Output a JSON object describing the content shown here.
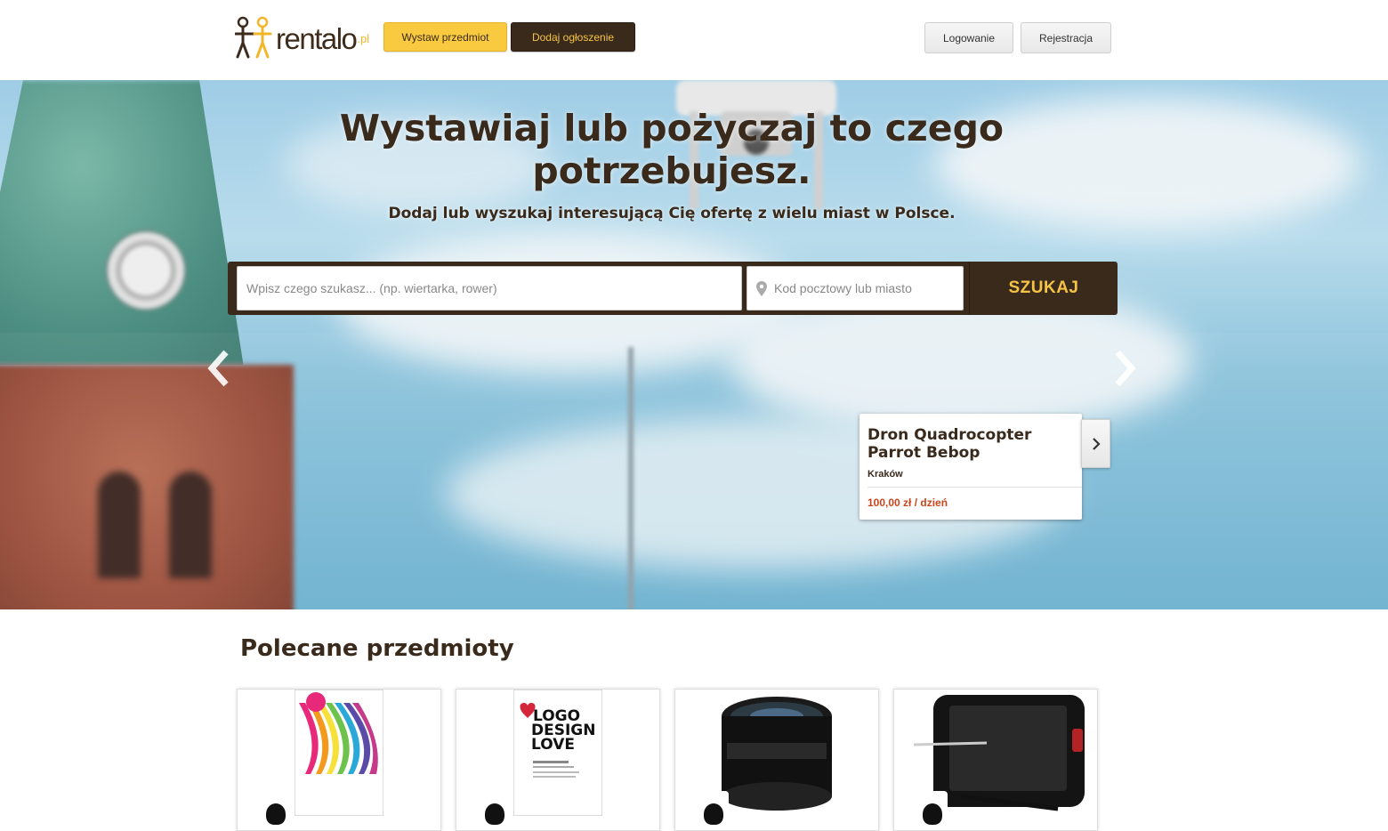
{
  "header": {
    "logo_text": "rentalo",
    "logo_tld": ".pl",
    "btn_list_item": "Wystaw przedmiot",
    "btn_add_ad": "Dodaj ogłoszenie",
    "btn_login": "Logowanie",
    "btn_register": "Rejestracja"
  },
  "hero": {
    "title": "Wystawiaj lub pożyczaj to czego potrzebujesz.",
    "subtitle": "Dodaj lub wyszukaj interesującą Cię ofertę z wielu miast w Polsce.",
    "search_placeholder": "Wpisz czego szukasz... (np. wiertarka, rower)",
    "location_placeholder": "Kod pocztowy lub miasto",
    "search_button": "SZUKAJ"
  },
  "featured_slide": {
    "title": "Dron Quadrocopter Parrot Bebop",
    "city": "Kraków",
    "price": "100,00 zł / dzień"
  },
  "featured": {
    "section_title": "Polecane przedmioty",
    "items": [
      {
        "image": "book-dtp"
      },
      {
        "image": "book-logo-design-love",
        "book_text": "LOGO DESIGN LOVE"
      },
      {
        "image": "camera-lens"
      },
      {
        "image": "drawing-tablet"
      }
    ]
  },
  "colors": {
    "brand_dark": "#3a2a1c",
    "brand_yellow": "#f9c93f",
    "price_red": "#c9461c"
  }
}
